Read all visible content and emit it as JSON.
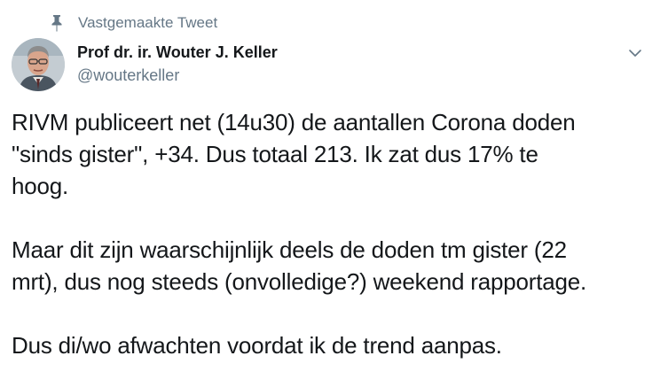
{
  "pinned_label": "Vastgemaakte Tweet",
  "author": {
    "display_name": "Prof dr. ir. Wouter J. Keller",
    "handle": "@wouterkeller"
  },
  "tweet": {
    "paragraphs": [
      "RIVM publiceert net (14u30) de aantallen Corona doden\n\"sinds gister\", +34. Dus totaal 213. Ik zat dus 17% te\nhoog.",
      "Maar dit zijn waarschijnlijk deels de doden tm gister (22\nmrt), dus nog steeds (onvolledige?) weekend rapportage.",
      "Dus di/wo afwachten voordat ik de trend aanpas."
    ]
  },
  "icons": {
    "pin": "pin-icon",
    "caret": "chevron-down-icon",
    "avatar": "avatar"
  },
  "colors": {
    "text": "#14171a",
    "secondary": "#657786",
    "background": "#ffffff"
  }
}
